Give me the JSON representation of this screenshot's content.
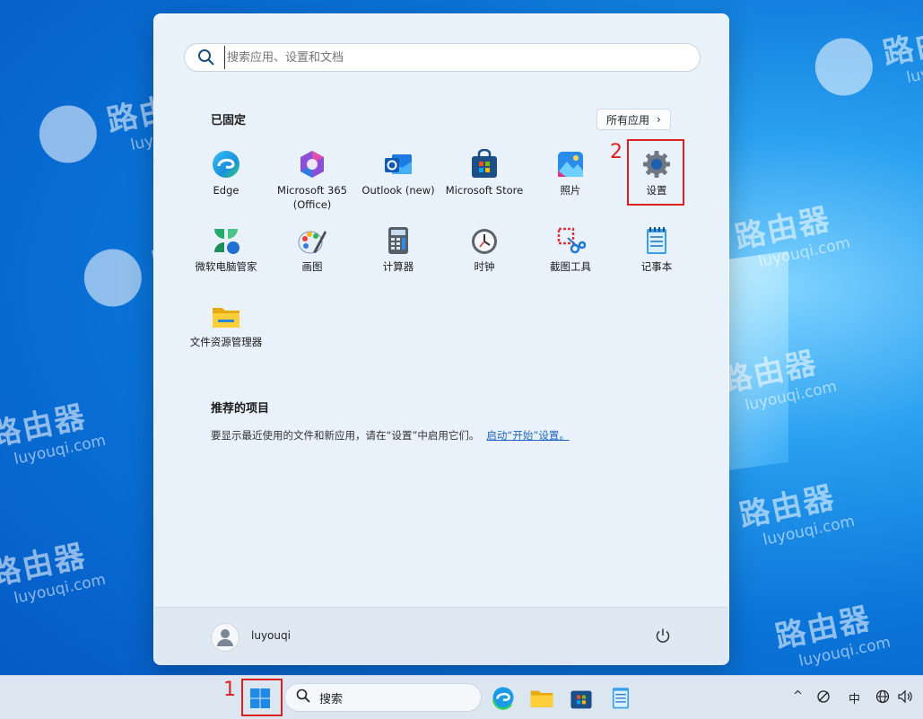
{
  "watermark": {
    "brand_cn": "路由器",
    "brand_domain": "luyouqi.com"
  },
  "start_menu": {
    "search_placeholder": "搜索应用、设置和文档",
    "pinned_title": "已固定",
    "all_apps_label": "所有应用",
    "apps": [
      {
        "name": "Edge",
        "icon": "edge-icon"
      },
      {
        "name": "Microsoft 365\n(Office)",
        "icon": "m365-icon"
      },
      {
        "name": "Outlook (new)",
        "icon": "outlook-icon"
      },
      {
        "name": "Microsoft Store",
        "icon": "store-icon"
      },
      {
        "name": "照片",
        "icon": "photos-icon"
      },
      {
        "name": "设置",
        "icon": "gear-icon"
      },
      {
        "name": "微软电脑管家",
        "icon": "pc-manager-icon"
      },
      {
        "name": "画图",
        "icon": "paint-icon"
      },
      {
        "name": "计算器",
        "icon": "calculator-icon"
      },
      {
        "name": "时钟",
        "icon": "clock-icon"
      },
      {
        "name": "截图工具",
        "icon": "snipping-icon"
      },
      {
        "name": "记事本",
        "icon": "notepad-icon"
      },
      {
        "name": "文件资源管理器",
        "icon": "folder-icon"
      }
    ],
    "recommended_title": "推荐的项目",
    "recommended_desc": "要显示最近使用的文件和新应用，请在“设置”中启用它们。",
    "recommended_link": "启动“开始”设置。",
    "user_name": "luyouqi"
  },
  "annotations": {
    "step1": "1",
    "step2": "2",
    "highlight_color": "#e02020"
  },
  "taskbar": {
    "search_label": "搜索",
    "ime_label": "中"
  }
}
